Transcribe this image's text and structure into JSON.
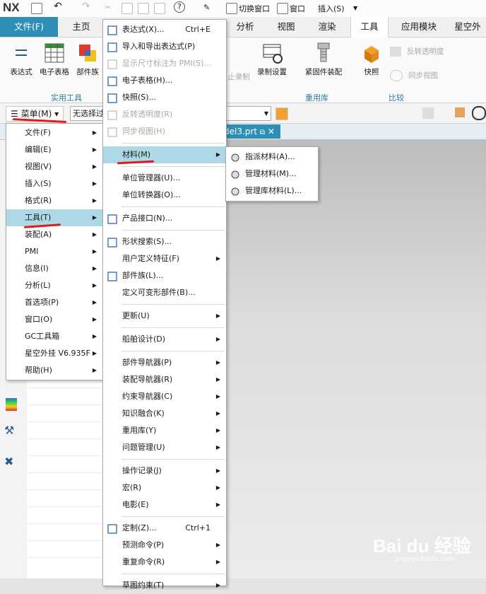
{
  "app": {
    "logo": "NX"
  },
  "qat": {
    "switch_window": "切换窗口",
    "window": "窗口",
    "insert": "插入(S)"
  },
  "tabs": [
    "文件(F)",
    "主页",
    "分析",
    "视图",
    "渲染",
    "工具",
    "应用模块",
    "星空外"
  ],
  "ribbon": {
    "expression": "表达式",
    "spreadsheet": "电子表格",
    "part_family": "部件族",
    "group_utility": "实用工具",
    "stop_record": "止录制",
    "record_settings": "录制设置",
    "fastener_assembly": "紧固件装配",
    "group_reuse": "重用库",
    "snapshot": "快照",
    "reverse_transparency": "反转透明度",
    "sync_view": "同步视图",
    "group_compare": "比较"
  },
  "selbar": {
    "menu": "菜单(M)",
    "filter": "无选择过"
  },
  "file_tab": "del3.prt",
  "main_menu": [
    "文件(F)",
    "编辑(E)",
    "视图(V)",
    "插入(S)",
    "格式(R)",
    "工具(T)",
    "装配(A)",
    "PMI",
    "信息(I)",
    "分析(L)",
    "首选项(P)",
    "窗口(O)",
    "GC工具箱",
    "星空外挂 V6.935F",
    "帮助(H)"
  ],
  "tools_menu": {
    "items": [
      {
        "label": "表达式(X)...",
        "shortcut": "Ctrl+E",
        "icon": "expression-icon"
      },
      {
        "label": "导入和导出表达式(P)",
        "icon": "import-export-icon"
      },
      {
        "label": "显示尺寸标注为 PMI(S)...",
        "icon": "dimension-pmi-icon",
        "disabled": true
      },
      {
        "label": "电子表格(H)...",
        "icon": "spreadsheet-icon"
      },
      {
        "label": "快照(S)...",
        "icon": "snapshot-icon"
      },
      {
        "label": "反转透明度(R)",
        "icon": "reverse-transparency-icon",
        "disabled": true
      },
      {
        "label": "同步视图(H)",
        "icon": "sync-view-icon",
        "disabled": true
      },
      {
        "label": "材料(M)",
        "submenu": true
      },
      {
        "label": "单位管理器(U)..."
      },
      {
        "label": "单位转换器(O)..."
      },
      {
        "label": "产品接口(N)...",
        "icon": "product-interface-icon"
      },
      {
        "label": "形状搜索(S)...",
        "icon": "shape-search-icon"
      },
      {
        "label": "用户定义特征(F)",
        "submenu": true
      },
      {
        "label": "部件族(L)...",
        "icon": "part-family-icon"
      },
      {
        "label": "定义可变形部件(B)..."
      },
      {
        "label": "更新(U)",
        "submenu": true
      },
      {
        "label": "船舶设计(D)",
        "submenu": true
      },
      {
        "label": "部件导航器(P)",
        "submenu": true
      },
      {
        "label": "装配导航器(R)",
        "submenu": true
      },
      {
        "label": "约束导航器(C)",
        "submenu": true
      },
      {
        "label": "知识融合(K)",
        "submenu": true
      },
      {
        "label": "重用库(Y)",
        "submenu": true
      },
      {
        "label": "问题管理(U)",
        "submenu": true
      },
      {
        "label": "操作记录(J)",
        "submenu": true
      },
      {
        "label": "宏(R)",
        "submenu": true
      },
      {
        "label": "电影(E)",
        "submenu": true
      },
      {
        "label": "定制(Z)...",
        "shortcut": "Ctrl+1",
        "icon": "customize-icon"
      },
      {
        "label": "预测命令(P)",
        "submenu": true
      },
      {
        "label": "重复命令(R)",
        "submenu": true
      },
      {
        "label": "草图约束(T)",
        "submenu": true
      }
    ]
  },
  "material_menu": [
    "指派材料(A)...",
    "管理材料(M)...",
    "管理库材料(L)..."
  ],
  "watermark": {
    "brand": "Bai du 经验",
    "url": "jingyan.baidu.com"
  },
  "colors": {
    "accent": "#2d8fb5",
    "highlight": "#add8e6",
    "annotation": "#e21b1b"
  }
}
